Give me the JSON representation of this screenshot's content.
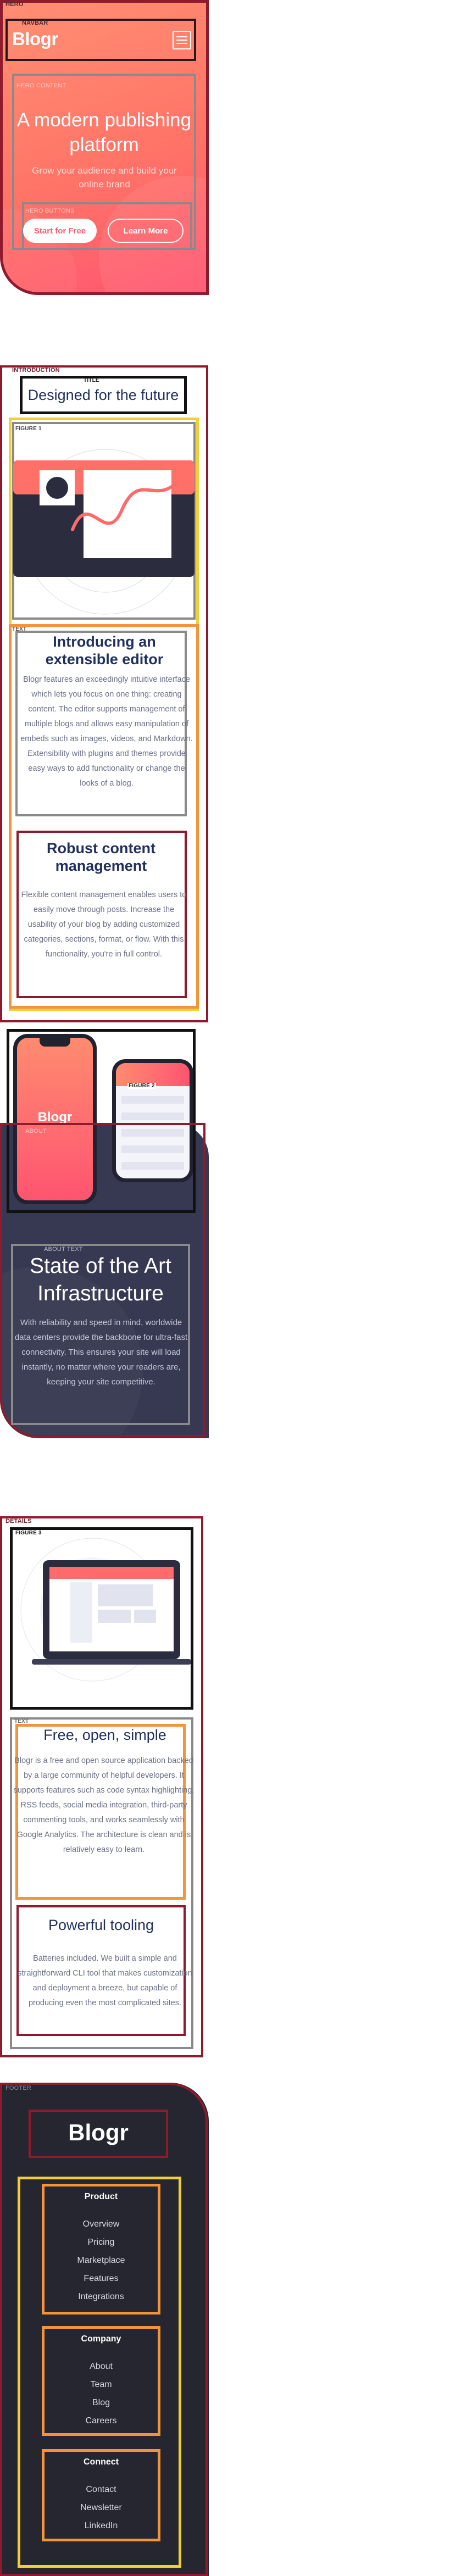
{
  "labels": {
    "hero": "HERO",
    "navbar": "NAVBAR",
    "hero_content": "HERO CONTENT",
    "hero_buttons": "HERO BUTTONS",
    "introduction": "INTRODUCTION",
    "title": "TITLE",
    "figure1": "FIGURE 1",
    "text": "TEXT",
    "figure2": "FIGURE 2",
    "about": "ABOUT",
    "about_text": "ABOUT TEXT",
    "details": "DETAILS",
    "figure3": "FIGURE 3",
    "text2": "TEXT",
    "footer": "FOOTER"
  },
  "brand": {
    "name": "Blogr"
  },
  "hero": {
    "title": "A modern publishing platform",
    "subtitle": "Grow your audience and build your online brand",
    "primary_button": "Start for Free",
    "secondary_button": "Learn More"
  },
  "intro": {
    "title": "Designed for the future",
    "blocks": [
      {
        "heading": "Introducing an extensible editor",
        "body": "Blogr features an exceedingly intuitive interface which lets you focus on one thing: creating content. The editor supports management of multiple blogs and allows easy manipulation of embeds such as images, videos, and Markdown. Extensibility with plugins and themes provide easy ways to add functionality or change the looks of a blog."
      },
      {
        "heading": "Robust content management",
        "body": "Flexible content management enables users to easily move through posts. Increase the usability of your blog by adding customized categories, sections, format, or flow. With this functionality, you're in full control."
      }
    ]
  },
  "phones": {
    "phone_brand": "Blogr"
  },
  "infra": {
    "title": "State of the Art Infrastructure",
    "body": "With reliability and speed in mind, worldwide data centers provide the backbone for ultra-fast connectivity. This ensures your site will load instantly, no matter where your readers are, keeping your site competitive."
  },
  "details": {
    "blocks": [
      {
        "heading": "Free, open, simple",
        "body": "Blogr is a free and open source application backed by a large community of helpful developers. It supports features such as code syntax highlighting, RSS feeds, social media integration, third-party commenting tools, and works seamlessly with Google Analytics. The architecture is clean and is relatively easy to learn."
      },
      {
        "heading": "Powerful tooling",
        "body": "Batteries included. We built a simple and straightforward CLI tool that makes customization and deployment a breeze, but capable of producing even the most complicated sites."
      }
    ]
  },
  "footer": {
    "columns": [
      {
        "heading": "Product",
        "links": [
          "Overview",
          "Pricing",
          "Marketplace",
          "Features",
          "Integrations"
        ]
      },
      {
        "heading": "Company",
        "links": [
          "About",
          "Team",
          "Blog",
          "Careers"
        ]
      },
      {
        "heading": "Connect",
        "links": [
          "Contact",
          "Newsletter",
          "LinkedIn"
        ]
      }
    ]
  },
  "colors": {
    "hero_gradient_start": "#ff8f73",
    "hero_gradient_end": "#ff5470",
    "navy_heading": "#1f2f5e",
    "dark_section": "#363951",
    "footer_bg": "#25262f"
  },
  "icons": {
    "menu": "hamburger-menu-icon"
  }
}
